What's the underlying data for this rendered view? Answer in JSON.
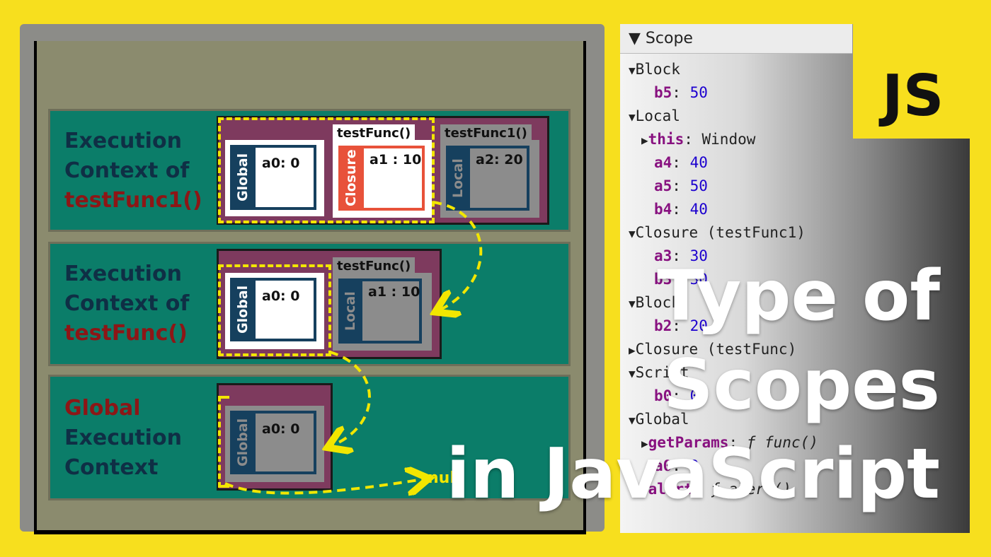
{
  "contexts": [
    {
      "line1": "Execution",
      "line2": "Context of",
      "line3": "testFunc1()"
    },
    {
      "line1": "Execution",
      "line2": "Context of",
      "line3": "testFunc()"
    },
    {
      "line1": "Global",
      "line2": "Execution",
      "line3": "Context"
    }
  ],
  "row1": {
    "global_label": "Global",
    "global_value": "a0: 0",
    "closure_title": "testFunc()",
    "closure_label": "Closure",
    "closure_value": "a1 : 10",
    "local_title": "testFunc1()",
    "local_label": "Local",
    "local_value": "a2: 20"
  },
  "row2": {
    "global_label": "Global",
    "global_value": "a0: 0",
    "local_title": "testFunc()",
    "local_label": "Local",
    "local_value": "a1 : 10"
  },
  "row3": {
    "global_label": "Global",
    "global_value": "a0: 0",
    "null_label": "null"
  },
  "devtools": {
    "header": "Scope",
    "lines": [
      {
        "arrow": "▼",
        "key": "Block",
        "value": ""
      },
      {
        "arrow": "",
        "key": "b5",
        "value": "50"
      },
      {
        "arrow": "▼",
        "key": "Local",
        "value": ""
      },
      {
        "arrow": "▶",
        "key": "this",
        "value": "Window"
      },
      {
        "arrow": "",
        "key": "a4",
        "value": "40"
      },
      {
        "arrow": "",
        "key": "a5",
        "value": "50"
      },
      {
        "arrow": "",
        "key": "b4",
        "value": "40"
      },
      {
        "arrow": "▼",
        "key": "Closure (testFunc1)",
        "value": ""
      },
      {
        "arrow": "",
        "key": "a3",
        "value": "30"
      },
      {
        "arrow": "",
        "key": "b3",
        "value": "30"
      },
      {
        "arrow": "▼",
        "key": "Block",
        "value": ""
      },
      {
        "arrow": "",
        "key": "b2",
        "value": "20"
      },
      {
        "arrow": "▶",
        "key": "Closure (testFunc)",
        "value": ""
      },
      {
        "arrow": "▼",
        "key": "Script",
        "value": ""
      },
      {
        "arrow": "",
        "key": "b0",
        "value": "0"
      },
      {
        "arrow": "▼",
        "key": "Global",
        "value": ""
      },
      {
        "arrow": "▶",
        "key": "getParams",
        "value": "ƒ func()"
      },
      {
        "arrow": "",
        "key": "a0",
        "value": "0"
      },
      {
        "arrow": "▶",
        "key": "alert",
        "value": "ƒ alert()"
      }
    ]
  },
  "badge": "JS",
  "title": {
    "line1": "Type of",
    "line2": "Scopes",
    "line3": "in JavaScript"
  },
  "colors": {
    "background": "#f7df1e",
    "context_row": "#0b7d69",
    "scope_outer": "#7e3a5e",
    "global_box": "#16405e",
    "closure_box": "#e8523a",
    "dashed": "#f2e600"
  }
}
